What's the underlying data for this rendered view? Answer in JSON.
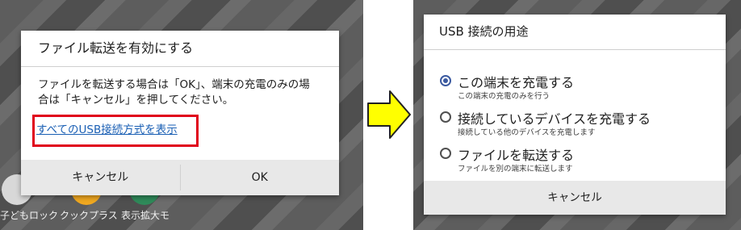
{
  "left_screen": {
    "background_apps": [
      {
        "label": "子どもロック",
        "icon": "child-lock-icon",
        "color": "#d8d8d8"
      },
      {
        "label": "クックプラス",
        "icon": "cook-plus-icon",
        "color": "#f0a820"
      },
      {
        "label": "表示拡大モ",
        "icon": "zoom-display-icon",
        "color": "#2f8a5a"
      }
    ],
    "dialog": {
      "title": "ファイル転送を有効にする",
      "message_line1": "ファイルを転送する場合は「OK」、端末の充電のみの場",
      "message_line2": "合は「キャンセル」を押してください。",
      "link": "すべてのUSB接続方式を表示",
      "cancel_label": "キャンセル",
      "ok_label": "OK"
    }
  },
  "arrow": {
    "icon": "right-arrow-icon",
    "fill": "#ffff00",
    "stroke": "#222222"
  },
  "right_screen": {
    "dialog": {
      "title": "USB 接続の用途",
      "options": [
        {
          "label": "この端末を充電する",
          "sub": "この端末の充電のみを行う",
          "selected": true
        },
        {
          "label": "接続しているデバイスを充電する",
          "sub": "接続している他のデバイスを充電します",
          "selected": false
        },
        {
          "label": "ファイルを転送する",
          "sub": "ファイルを別の端末に転送します",
          "selected": false
        }
      ],
      "cancel_label": "キャンセル"
    }
  },
  "colors": {
    "highlight_border": "#e0001b",
    "link": "#1a5fb4",
    "radio_selected": "#3b5aa0",
    "button_bar": "#e8e8e8"
  }
}
